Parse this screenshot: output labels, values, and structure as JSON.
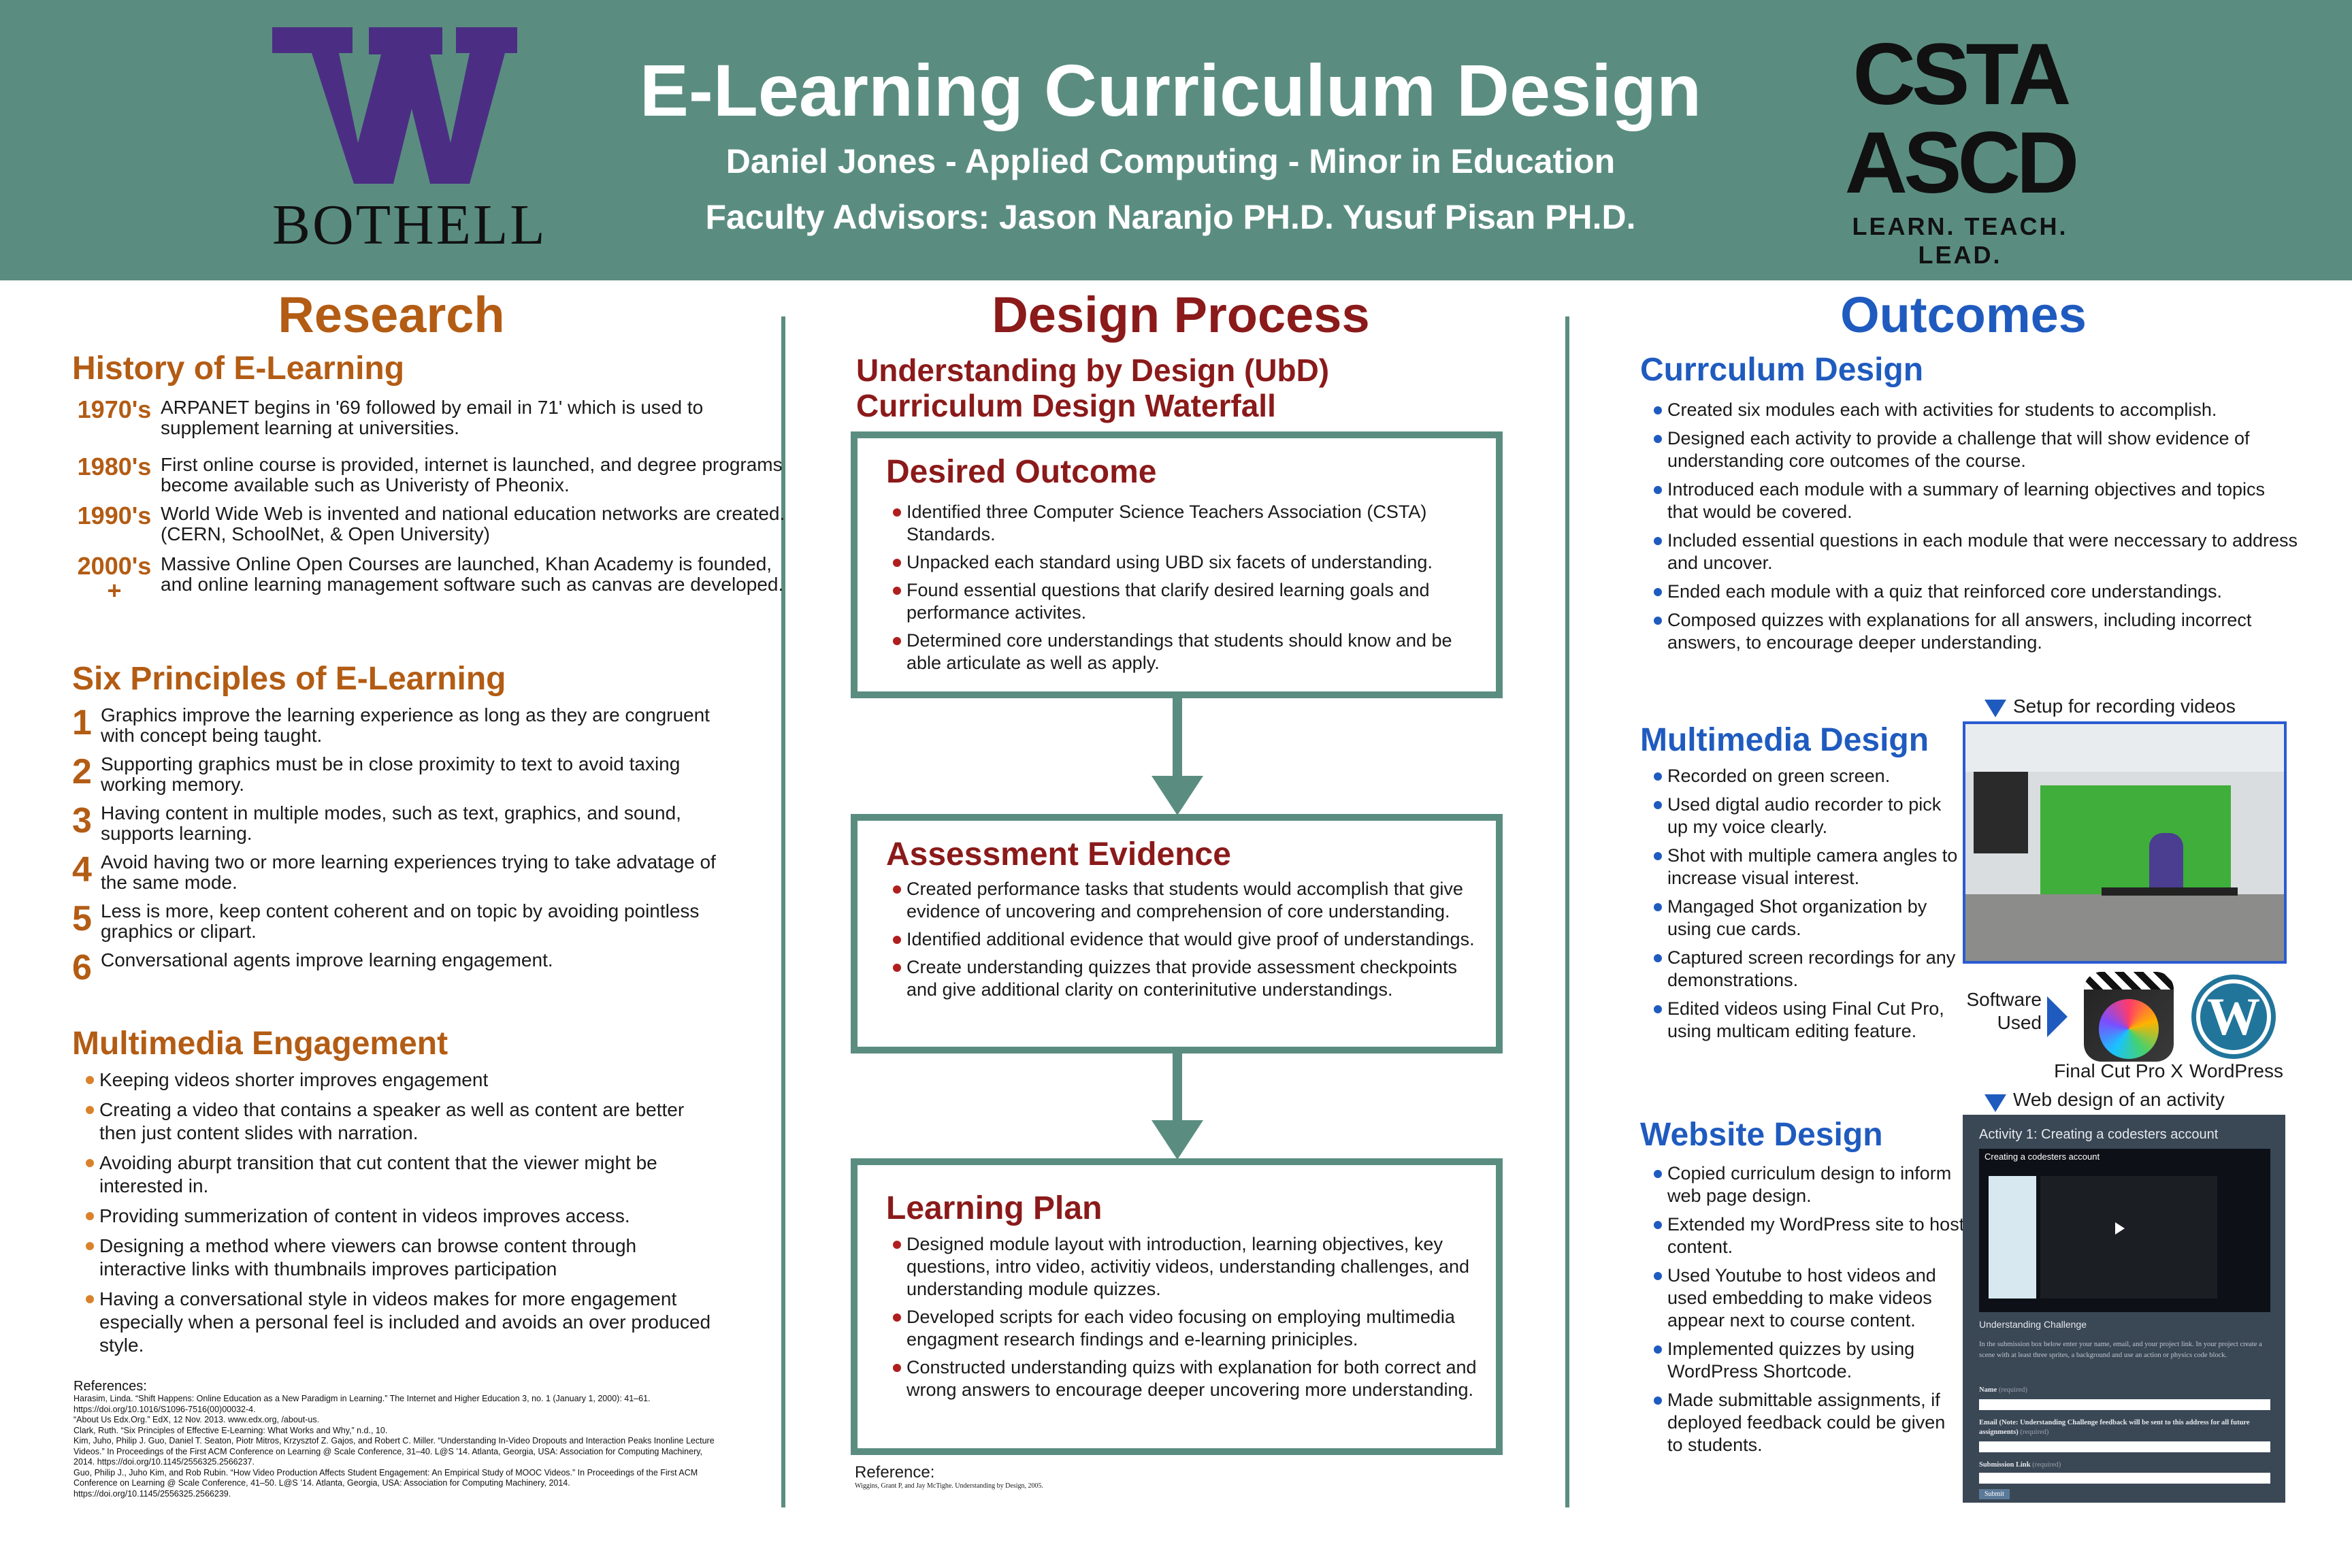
{
  "header": {
    "logo_left_letter": "W",
    "logo_left_text": "BOTHELL",
    "title": "E-Learning Curriculum Design",
    "author": "Daniel Jones - Applied Computing - Minor in Education",
    "advisors": "Faculty Advisors: Jason Naranjo PH.D.  Yusuf Pisan PH.D.",
    "logo_right_top": "CSTA",
    "logo_right_bottom": "ASCD",
    "logo_right_tagline": "LEARN. TEACH. LEAD."
  },
  "research": {
    "title": "Research",
    "history_title": "History of E-Learning",
    "history": [
      {
        "era": "1970's",
        "text": "ARPANET begins in '69 followed by email in 71' which is used to supplement learning at universities."
      },
      {
        "era": "1980's",
        "text": "First online course is provided, internet is launched, and degree programs become available such as Univeristy of Pheonix."
      },
      {
        "era": "1990's",
        "text": "World Wide Web is invented and national education networks are created. (CERN, SchoolNet, & Open University)"
      },
      {
        "era": "2000's +",
        "text": "Massive Online Open Courses are launched, Khan Academy is founded, and online learning management software such as canvas are developed."
      }
    ],
    "principles_title": "Six Principles of E-Learning",
    "principles": [
      {
        "num": "1",
        "text": "Graphics improve the learning experience as long as they are congruent with concept being taught."
      },
      {
        "num": "2",
        "text": "Supporting graphics must be in close proximity to text to avoid taxing working memory."
      },
      {
        "num": "3",
        "text": "Having content in multiple modes, such as text, graphics, and sound, supports learning."
      },
      {
        "num": "4",
        "text": "Avoid having two or more learning experiences trying to take advatage of the same mode."
      },
      {
        "num": "5",
        "text": "Less is more, keep content coherent and on topic by avoiding pointless graphics or clipart."
      },
      {
        "num": "6",
        "text": "Conversational agents improve learning engagement."
      }
    ],
    "engagement_title": "Multimedia Engagement",
    "engagement": [
      "Keeping videos shorter improves engagement",
      "Creating a video that contains a speaker as well as content are better then just content slides with narration.",
      "Avoiding aburpt transition that cut content that the viewer might be interested in.",
      "Providing summerization of content in videos improves access.",
      "Designing a method where viewers can browse content through interactive links with thumbnails improves participation",
      "Having a conversational style in videos makes for more engagement especially when a personal feel is included and avoids an over produced style."
    ],
    "references_label": "References:",
    "references": [
      "Harasim, Linda. “Shift Happens: Online Education as a New Paradigm in Learning.” The Internet and Higher Education 3, no. 1 (January 1, 2000): 41–61. https://doi.org/10.1016/S1096-7516(00)00032-4.",
      "“About Us Edx.Org.” EdX, 12 Nov. 2013. www.edx.org, /about-us.",
      "Clark, Ruth. “Six Principles of Effective E-Learning: What Works and Why,” n.d., 10.",
      "Kim, Juho, Philip J. Guo, Daniel T. Seaton, Piotr Mitros, Krzysztof Z. Gajos, and Robert C. Miller. “Understanding In-Video Dropouts and Interaction Peaks Inonline Lecture Videos.” In Proceedings of the First ACM Conference on Learning @ Scale Conference, 31–40. L@S ’14. Atlanta, Georgia, USA: Association for Computing Machinery, 2014. https://doi.org/10.1145/2556325.2566237.",
      "Guo, Philip J., Juho Kim, and Rob Rubin. “How Video Production Affects Student Engagement: An Empirical Study of MOOC Videos.” In Proceedings of the First ACM Conference on Learning @ Scale Conference, 41–50. L@S ’14. Atlanta, Georgia, USA: Association for Computing Machinery, 2014. https://doi.org/10.1145/2556325.2566239."
    ]
  },
  "design": {
    "title": "Design Process",
    "ubd_line1": "Understanding by Design (UbD)",
    "ubd_line2": "Curriculum Design Waterfall",
    "boxes": [
      {
        "title": "Desired Outcome",
        "items": [
          "Identified three Computer Science Teachers Association (CSTA) Standards.",
          "Unpacked each standard using UBD six facets of understanding.",
          "Found essential questions that clarify desired learning goals and performance activites.",
          "Determined core understandings that students should know and be able articulate as well as apply."
        ]
      },
      {
        "title": "Assessment Evidence",
        "items": [
          "Created performance tasks that students would accomplish that give evidence of uncovering and comprehension of core understanding.",
          "Identified additional evidence that would give proof of understandings.",
          "Create understanding quizzes that provide assessment checkpoints and give additional clarity on conterinitutive understandings."
        ]
      },
      {
        "title": "Learning Plan",
        "items": [
          "Designed module layout with introduction, learning objectives, key questions, intro video, activitiy videos, understanding challenges, and understanding module quizzes.",
          "Developed scripts for each video focusing on employing multimedia engagment research findings and e-learning priniciples.",
          "Constructed understanding quizs with explanation for both correct and wrong answers to encourage deeper uncovering more understanding."
        ]
      }
    ],
    "reference_label": "Reference:",
    "reference": "Wiggins, Grant P, and Jay McTighe. Understanding by Design, 2005."
  },
  "outcomes": {
    "title": "Outcomes",
    "curriculum_title": "Currculum Design",
    "curriculum": [
      "Created six modules each with activities for students to accomplish.",
      "Designed each activity to provide a challenge that will show evidence of understanding core outcomes of the course.",
      "Introduced each module with a summary of learning objectives and topics that would be covered.",
      "Included essential questions in each module that were neccessary to address and uncover.",
      "Ended each module with a quiz that reinforced core understandings.",
      "Composed quizzes with explanations for all answers, including incorrect answers, to encourage deeper understanding."
    ],
    "multimedia_title": "Multimedia Design",
    "multimedia": [
      "Recorded on green screen.",
      "Used digtal audio recorder to pick up my voice clearly.",
      "Shot with multiple camera angles to increase visual interest.",
      "Mangaged Shot organization by using cue cards.",
      "Captured screen recordings for any demonstrations.",
      "Edited videos using Final Cut Pro, using multicam editing feature."
    ],
    "setup_caption": "Setup for recording videos",
    "software_label": "Software Used",
    "software": [
      "Final Cut Pro X",
      "WordPress"
    ],
    "webdesign_caption": "Web design of an activity",
    "website_title": "Website Design",
    "website": [
      "Copied curriculum design to inform web page design.",
      "Extended my WordPress site to host content.",
      "Used Youtube to host videos and used embedding to make videos appear next to course content.",
      "Implemented quizzes by using WordPress Shortcode.",
      "Made submittable assignments, if deployed feedback could be given to students."
    ],
    "webshot": {
      "title": "Activity 1: Creating a codesters account",
      "video_title": "Creating a codesters account",
      "challenge": "Understanding Challenge",
      "desc": "In the submission box below enter your name, email, and your project link. In your project create a scene with at least three sprites, a background and use an action or physics code block.",
      "name_label": "Name",
      "name_req": "(required)",
      "email_label": "Email (Note: Understanding Challenge feedback will be sent to this address for all future assignments)",
      "email_req": "(required)",
      "link_label": "Submission Link",
      "link_req": "(required)",
      "submit": "Submit"
    }
  },
  "colors": {
    "header_bg": "#5a8d80",
    "research": "#b35c14",
    "design": "#8b1a1a",
    "outcomes": "#1f5bbf",
    "uw_purple": "#4b2e83"
  }
}
